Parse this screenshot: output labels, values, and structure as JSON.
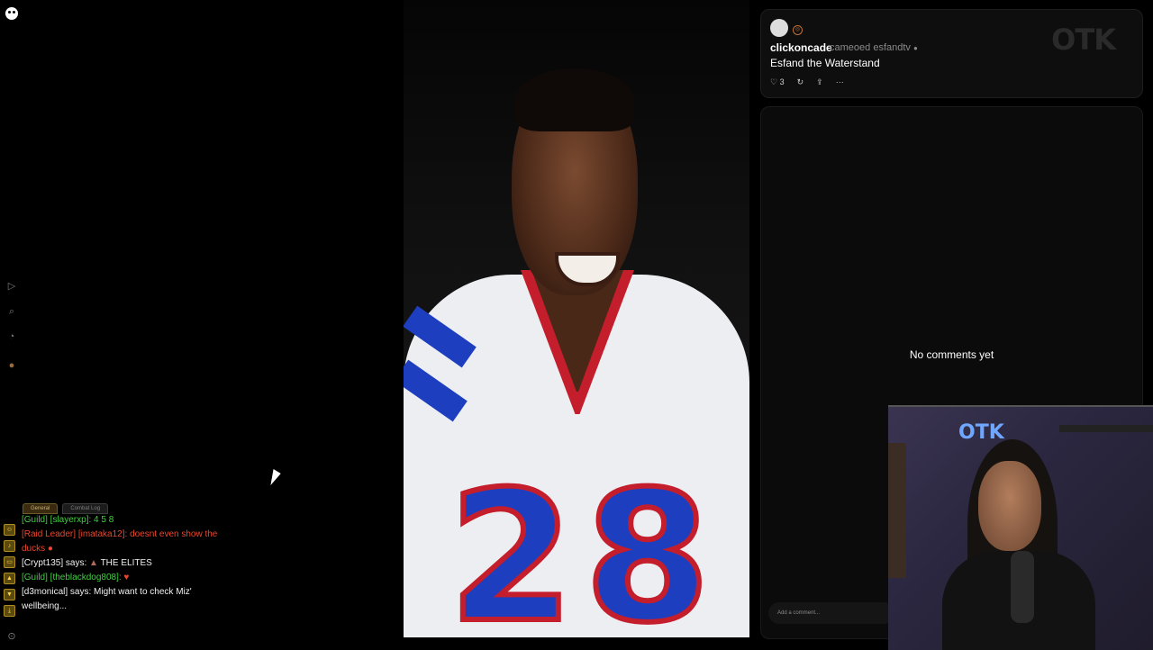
{
  "post": {
    "username": "clickoncade",
    "action": "cameoed",
    "target": "esfandtv",
    "title": "Esfand the Waterstand",
    "likes": "3",
    "icons": {
      "like": "heart-icon",
      "remix": "remix-icon",
      "share": "share-icon",
      "more": "more-icon"
    }
  },
  "watermark": "OTK",
  "comments": {
    "empty_text": "No comments yet",
    "input_placeholder": "Add a comment..."
  },
  "video": {
    "jersey_number": "28"
  },
  "chat": {
    "tabs": [
      "General",
      "Combat Log"
    ],
    "lines": [
      {
        "prefix": "[Guild] [slayerxp]:",
        "text": "4 5 8",
        "kind": "guild"
      },
      {
        "prefix": "[Raid Leader] [imataka12]:",
        "text": "doesnt even show the ducks",
        "kind": "raid"
      },
      {
        "prefix": "[Crypt135] says:",
        "text": "THE ELITES",
        "kind": "say"
      },
      {
        "prefix": "[Guild] [theblackdog808]:",
        "text": "",
        "kind": "guild"
      },
      {
        "prefix": "[d3monical] says:",
        "text": "Might want to check Miz' wellbeing...",
        "kind": "say"
      }
    ]
  },
  "colors": {
    "guild": "#40d040",
    "raid": "#e8472e",
    "accent": "#1d3fbf"
  }
}
